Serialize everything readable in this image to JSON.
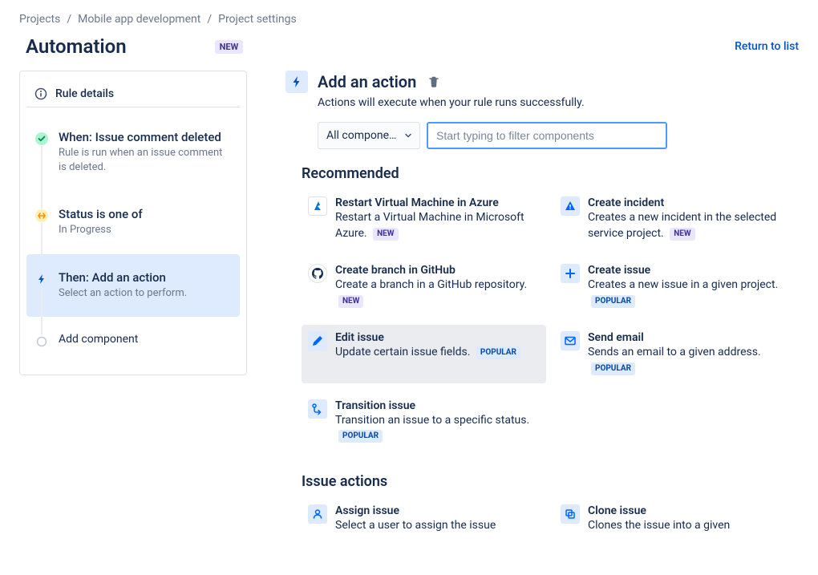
{
  "breadcrumb": {
    "items": [
      "Projects",
      "Mobile app development",
      "Project settings"
    ]
  },
  "header": {
    "title": "Automation",
    "badge": "NEW",
    "return": "Return to list"
  },
  "sidebar": {
    "rule_details": "Rule details",
    "steps": [
      {
        "title": "When: Issue comment deleted",
        "desc": "Rule is run when an issue comment is deleted."
      },
      {
        "title": "Status is one of",
        "desc": "In Progress"
      },
      {
        "title": "Then: Add an action",
        "desc": "Select an action to perform."
      },
      {
        "title": "Add component",
        "desc": ""
      }
    ]
  },
  "main": {
    "title": "Add an action",
    "subtitle": "Actions will execute when your rule runs successfully.",
    "dropdown": "All compone…",
    "search_placeholder": "Start typing to filter components",
    "sections": {
      "recommended": {
        "title": "Recommended",
        "items": [
          {
            "title": "Restart Virtual Machine in Azure",
            "desc": "Restart a Virtual Machine in Microsoft Azure.",
            "badge": "NEW"
          },
          {
            "title": "Create incident",
            "desc": "Creates a new incident in the selected service project.",
            "badge": "NEW"
          },
          {
            "title": "Create branch in GitHub",
            "desc": "Create a branch in a GitHub repository.",
            "badge": "NEW"
          },
          {
            "title": "Create issue",
            "desc": "Creates a new issue in a given project.",
            "badge": "POPULAR"
          },
          {
            "title": "Edit issue",
            "desc": "Update certain issue fields.",
            "badge": "POPULAR"
          },
          {
            "title": "Send email",
            "desc": "Sends an email to a given address.",
            "badge": "POPULAR"
          },
          {
            "title": "Transition issue",
            "desc": "Transition an issue to a specific status.",
            "badge": "POPULAR"
          }
        ]
      },
      "issue_actions": {
        "title": "Issue actions",
        "items": [
          {
            "title": "Assign issue",
            "desc": "Select a user to assign the issue"
          },
          {
            "title": "Clone issue",
            "desc": "Clones the issue into a given"
          }
        ]
      }
    }
  }
}
